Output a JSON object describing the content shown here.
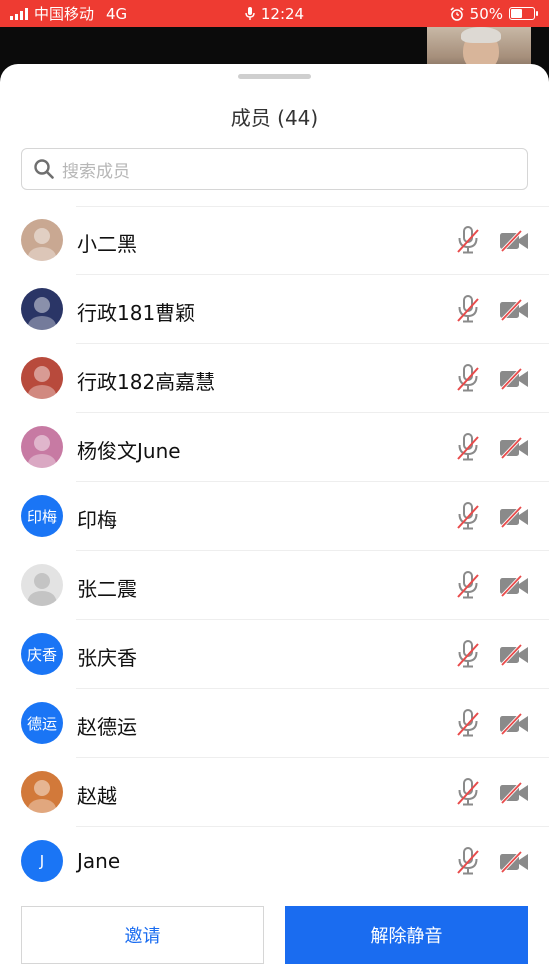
{
  "status_bar": {
    "carrier": "中国移动",
    "network": "4G",
    "time": "12:24",
    "battery": "50%",
    "battery_level": 0.5
  },
  "sheet": {
    "title": "成员 (44)",
    "search_placeholder": "搜索成员"
  },
  "members": [
    {
      "name": "小二黑",
      "avatar_type": "photo",
      "avatar_text": "",
      "avatar_color": "#c9a892",
      "mic": "muted",
      "camera": "off"
    },
    {
      "name": "行政181曹颖",
      "avatar_type": "photo",
      "avatar_text": "",
      "avatar_color": "#2a3566",
      "mic": "muted",
      "camera": "off"
    },
    {
      "name": "行政182高嘉慧",
      "avatar_type": "photo",
      "avatar_text": "",
      "avatar_color": "#b84a3c",
      "mic": "muted",
      "camera": "off"
    },
    {
      "name": "杨俊文June",
      "avatar_type": "photo",
      "avatar_text": "",
      "avatar_color": "#c77aa3",
      "mic": "muted",
      "camera": "off"
    },
    {
      "name": "印梅",
      "avatar_type": "text",
      "avatar_text": "印梅",
      "avatar_color": "#1a75f5",
      "mic": "muted",
      "camera": "off"
    },
    {
      "name": "张二震",
      "avatar_type": "default",
      "avatar_text": "",
      "avatar_color": "#e3e3e3",
      "mic": "muted",
      "camera": "off"
    },
    {
      "name": "张庆香",
      "avatar_type": "text",
      "avatar_text": "庆香",
      "avatar_color": "#1a75f5",
      "mic": "muted",
      "camera": "off"
    },
    {
      "name": "赵德运",
      "avatar_type": "text",
      "avatar_text": "德运",
      "avatar_color": "#1a75f5",
      "mic": "muted",
      "camera": "off"
    },
    {
      "name": "赵越",
      "avatar_type": "photo",
      "avatar_text": "",
      "avatar_color": "#d2793a",
      "mic": "muted",
      "camera": "off"
    },
    {
      "name": "Jane",
      "avatar_type": "text",
      "avatar_text": "J",
      "avatar_color": "#1a75f5",
      "mic": "muted",
      "camera": "off"
    }
  ],
  "actions": {
    "invite": "邀请",
    "unmute_all": "解除静音"
  },
  "icons": {
    "mic": "microphone-muted-icon",
    "camera": "camera-off-icon",
    "search": "search-icon"
  },
  "colors": {
    "status_bar": "#ee3b32",
    "primary": "#1a6cf0",
    "mute_slash": "#e84b4b"
  }
}
